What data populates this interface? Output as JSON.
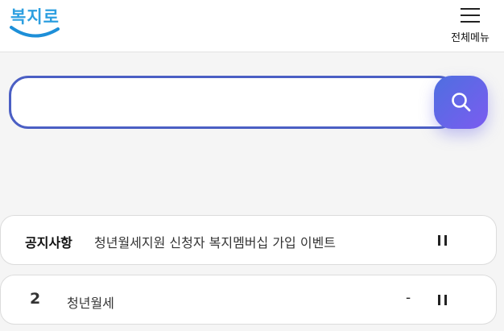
{
  "header": {
    "logo_text": "복지로",
    "menu_label": "전체메뉴",
    "logo_colors": {
      "text": "#2d9fe0",
      "smile": "#1d8fd8"
    }
  },
  "search": {
    "value": "",
    "placeholder": "",
    "border_color": "#4b5fc4",
    "button_gradient": [
      "#4e6fe0",
      "#7b5cf0"
    ]
  },
  "notice": {
    "label": "공지사항",
    "text": "청년월세지원 신청자 복지멤버십 가입 이벤트"
  },
  "ranking": {
    "items": [
      {
        "rank": "2",
        "keyword": "청년월세",
        "change": "-"
      }
    ]
  }
}
